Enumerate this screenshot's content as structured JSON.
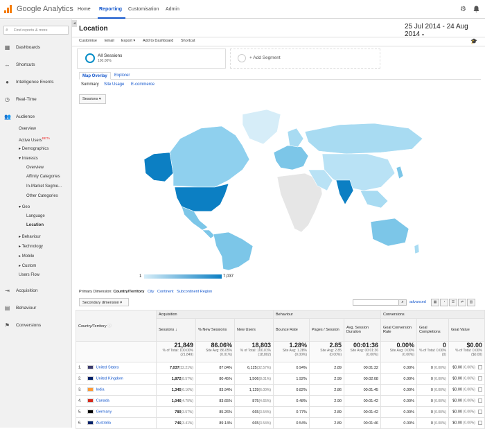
{
  "app": {
    "name": "Google Analytics"
  },
  "topnav": {
    "home": "Home",
    "reporting": "Reporting",
    "customisation": "Customisation",
    "admin": "Admin"
  },
  "sidebar": {
    "search_placeholder": "Find reports & more",
    "dashboards": "Dashboards",
    "shortcuts": "Shortcuts",
    "intelligence": "Intelligence Events",
    "realtime": "Real-Time",
    "audience": "Audience",
    "overview": "Overview",
    "active_users": "Active Users",
    "beta": "BETA",
    "demographics": "Demographics",
    "interests": "Interests",
    "int_overview": "Overview",
    "affinity": "Affinity Categories",
    "inmarket": "In-Market Segme...",
    "other_cat": "Other Categories",
    "geo": "Geo",
    "language": "Language",
    "location": "Location",
    "behaviour": "Behaviour",
    "technology": "Technology",
    "mobile": "Mobile",
    "custom": "Custom",
    "users_flow": "Users Flow",
    "acquisition": "Acquisition",
    "behaviour_main": "Behaviour",
    "conversions": "Conversions"
  },
  "page": {
    "title": "Location",
    "date_range": "25 Jul 2014 - 24 Aug 2014"
  },
  "toolbar": {
    "customise": "Customise",
    "email": "Email",
    "export": "Export",
    "add_dashboard": "Add to Dashboard",
    "shortcut": "Shortcut"
  },
  "segments": {
    "all_sessions": "All Sessions",
    "all_pct": "100.00%",
    "add": "+ Add Segment"
  },
  "tabs": {
    "map_overlay": "Map Overlay",
    "explorer": "Explorer"
  },
  "subtabs": {
    "summary": "Summary",
    "site_usage": "Site Usage",
    "ecommerce": "E-commerce"
  },
  "map": {
    "metric": "Sessions",
    "legend_min": "1",
    "legend_max": "7,037"
  },
  "dims": {
    "primary_label": "Primary Dimension:",
    "country": "Country/Territory",
    "city": "City",
    "continent": "Continent",
    "subcontinent": "Subcontinent Region",
    "secondary": "Secondary dimension",
    "advanced": "advanced"
  },
  "table": {
    "groups": {
      "acquisition": "Acquisition",
      "behaviour": "Behaviour",
      "conversions": "Conversions"
    },
    "headers": {
      "country": "Country/Territory",
      "sessions": "Sessions",
      "new_sessions": "% New Sessions",
      "new_users": "New Users",
      "bounce": "Bounce Rate",
      "pages": "Pages / Session",
      "duration": "Avg. Session Duration",
      "conv_rate": "Goal Conversion Rate",
      "completions": "Goal Completions",
      "value": "Goal Value"
    },
    "totals": [
      {
        "v": "21,849",
        "s": "% of Total: 100.00% (21,849)"
      },
      {
        "v": "86.06%",
        "s": "Site Avg: 86.05% (0.01%)"
      },
      {
        "v": "18,803",
        "s": "% of Total: 100.01% (18,802)"
      },
      {
        "v": "1.28%",
        "s": "Site Avg: 1.28% (0.00%)"
      },
      {
        "v": "2.85",
        "s": "Site Avg: 2.85 (0.00%)"
      },
      {
        "v": "00:01:36",
        "s": "Site Avg: 00:01:36 (0.00%)"
      },
      {
        "v": "0.00%",
        "s": "Site Avg: 0.00% (0.00%)"
      },
      {
        "v": "0",
        "s": "% of Total: 0.00% (0)"
      },
      {
        "v": "$0.00",
        "s": "% of Total: 0.00% ($0.00)"
      }
    ],
    "rows": [
      {
        "n": "1.",
        "c": "United States",
        "s": "7,037",
        "sp": "(32.21%)",
        "ns": "87.04%",
        "nu": "6,125",
        "nup": "(32.57%)",
        "b": "0.94%",
        "p": "2.89",
        "d": "00:01:32",
        "cr": "0.00%",
        "gc": "0",
        "gcp": "(0.00%)",
        "gv": "$0.00",
        "gvp": "(0.00%)",
        "flag": "#3c3b6e"
      },
      {
        "n": "2.",
        "c": "United Kingdom",
        "s": "1,872",
        "sp": "(8.57%)",
        "ns": "80.45%",
        "nu": "1,506",
        "nup": "(8.01%)",
        "b": "1.92%",
        "p": "2.99",
        "d": "00:02:08",
        "cr": "0.00%",
        "gc": "0",
        "gcp": "(0.00%)",
        "gv": "$0.00",
        "gvp": "(0.00%)",
        "flag": "#012169"
      },
      {
        "n": "3.",
        "c": "India",
        "s": "1,345",
        "sp": "(6.16%)",
        "ns": "83.94%",
        "nu": "1,129",
        "nup": "(6.00%)",
        "b": "0.82%",
        "p": "2.86",
        "d": "00:01:45",
        "cr": "0.00%",
        "gc": "0",
        "gcp": "(0.00%)",
        "gv": "$0.00",
        "gvp": "(0.00%)",
        "flag": "#ff9933"
      },
      {
        "n": "4.",
        "c": "Canada",
        "s": "1,046",
        "sp": "(4.79%)",
        "ns": "83.65%",
        "nu": "875",
        "nup": "(4.65%)",
        "b": "0.48%",
        "p": "2.90",
        "d": "00:01:42",
        "cr": "0.00%",
        "gc": "0",
        "gcp": "(0.00%)",
        "gv": "$0.00",
        "gvp": "(0.00%)",
        "flag": "#d52b1e"
      },
      {
        "n": "5.",
        "c": "Germany",
        "s": "780",
        "sp": "(3.57%)",
        "ns": "85.26%",
        "nu": "665",
        "nup": "(3.54%)",
        "b": "0.77%",
        "p": "2.89",
        "d": "00:01:42",
        "cr": "0.00%",
        "gc": "0",
        "gcp": "(0.00%)",
        "gv": "$0.00",
        "gvp": "(0.00%)",
        "flag": "#000000"
      },
      {
        "n": "6.",
        "c": "Australia",
        "s": "746",
        "sp": "(3.41%)",
        "ns": "89.14%",
        "nu": "665",
        "nup": "(3.54%)",
        "b": "0.54%",
        "p": "2.89",
        "d": "00:01:46",
        "cr": "0.00%",
        "gc": "0",
        "gcp": "(0.00%)",
        "gv": "$0.00",
        "gvp": "(0.00%)",
        "flag": "#012169"
      }
    ]
  },
  "colors": {
    "accent": "#15c",
    "map_light": "#d6edf8",
    "map_mid": "#7cc6e8",
    "map_dark": "#0c7fc3",
    "logo_orange": "#f57c00"
  }
}
